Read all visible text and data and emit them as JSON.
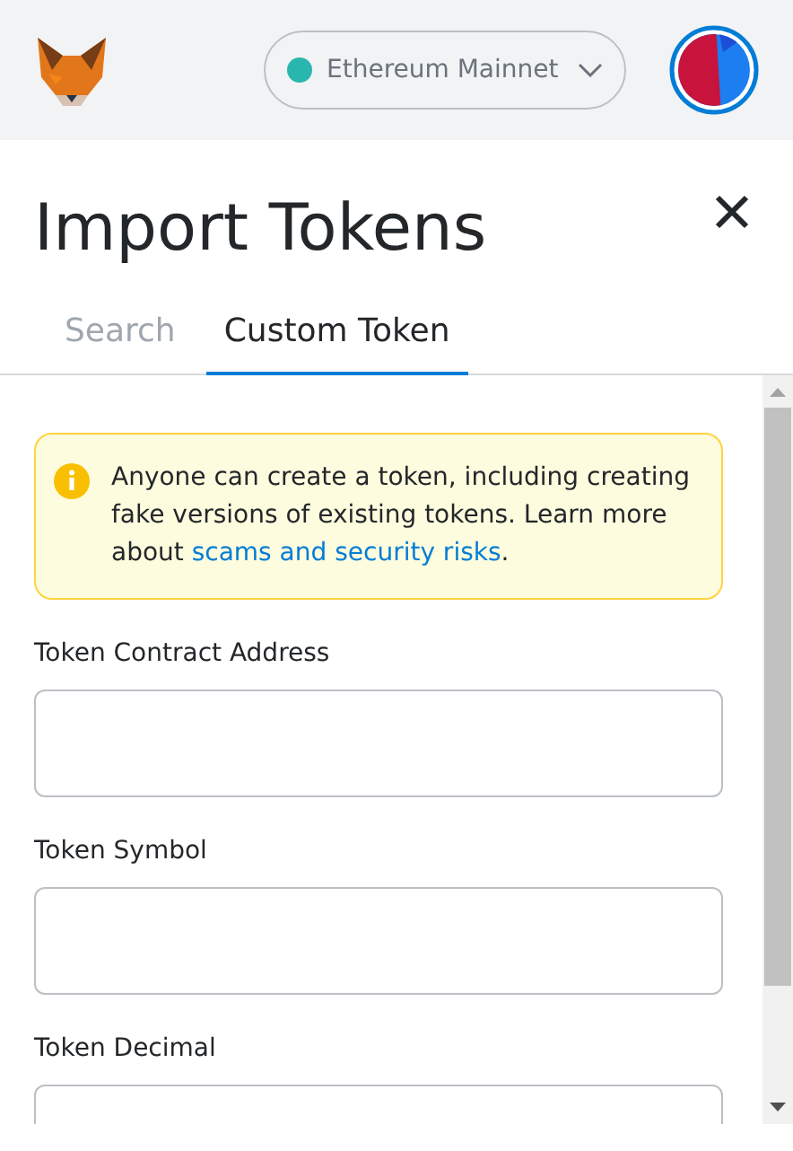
{
  "header": {
    "network": {
      "label": "Ethereum Mainnet",
      "color": "#29b6af"
    }
  },
  "title": "Import Tokens",
  "tabs": [
    {
      "label": "Search",
      "selected": false
    },
    {
      "label": "Custom Token",
      "selected": true
    }
  ],
  "warning": {
    "text": "Anyone can create a token, including creating fake versions of existing tokens. Learn more about ",
    "link": "scams and security risks",
    "after": "."
  },
  "fields": [
    {
      "label": "Token Contract Address"
    },
    {
      "label": "Token Symbol"
    },
    {
      "label": "Token Decimal"
    }
  ]
}
